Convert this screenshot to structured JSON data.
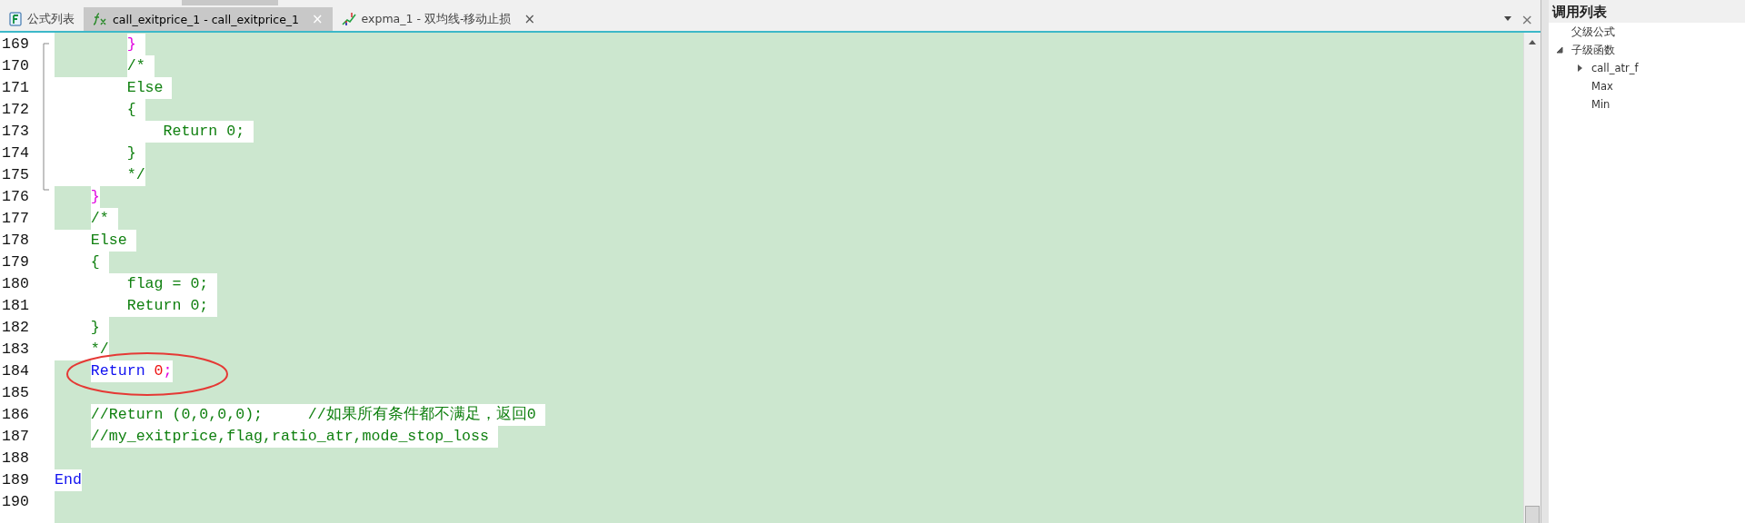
{
  "tabs": [
    {
      "label": "公式列表",
      "kind": "list",
      "selected": false
    },
    {
      "label": "call_exitprice_1 - call_exitprice_1",
      "kind": "function",
      "selected": true,
      "close": "×"
    },
    {
      "label": "expma_1 - 双均线-移动止损",
      "kind": "chart",
      "selected": false,
      "close": "×"
    }
  ],
  "tab_bar_close": "×",
  "editor": {
    "lines": [
      {
        "number": "169",
        "lead_highlight": false,
        "circled": false,
        "tokens": [
          {
            "text": "        } ",
            "kind": "brace"
          }
        ]
      },
      {
        "number": "170",
        "lead_highlight": false,
        "circled": false,
        "tokens": [
          {
            "text": "        /* ",
            "kind": "comment"
          }
        ]
      },
      {
        "number": "171",
        "lead_highlight": true,
        "circled": false,
        "tokens": [
          {
            "text": "        Else ",
            "kind": "comment"
          }
        ]
      },
      {
        "number": "172",
        "lead_highlight": true,
        "circled": false,
        "tokens": [
          {
            "text": "        { ",
            "kind": "comment"
          }
        ]
      },
      {
        "number": "173",
        "lead_highlight": true,
        "circled": false,
        "tokens": [
          {
            "text": "            Return 0; ",
            "kind": "comment"
          }
        ]
      },
      {
        "number": "174",
        "lead_highlight": true,
        "circled": false,
        "tokens": [
          {
            "text": "        } ",
            "kind": "comment"
          }
        ]
      },
      {
        "number": "175",
        "lead_highlight": true,
        "circled": false,
        "tokens": [
          {
            "text": "        */",
            "kind": "comment"
          }
        ]
      },
      {
        "number": "176",
        "lead_highlight": false,
        "circled": false,
        "tokens": [
          {
            "text": "    }",
            "kind": "brace"
          }
        ]
      },
      {
        "number": "177",
        "lead_highlight": false,
        "circled": false,
        "tokens": [
          {
            "text": "    /* ",
            "kind": "comment"
          }
        ]
      },
      {
        "number": "178",
        "lead_highlight": true,
        "circled": false,
        "tokens": [
          {
            "text": "    Else ",
            "kind": "comment"
          }
        ]
      },
      {
        "number": "179",
        "lead_highlight": true,
        "circled": false,
        "tokens": [
          {
            "text": "    { ",
            "kind": "comment"
          }
        ]
      },
      {
        "number": "180",
        "lead_highlight": true,
        "circled": false,
        "tokens": [
          {
            "text": "        flag = 0; ",
            "kind": "comment"
          }
        ]
      },
      {
        "number": "181",
        "lead_highlight": true,
        "circled": false,
        "tokens": [
          {
            "text": "        Return 0; ",
            "kind": "comment"
          }
        ]
      },
      {
        "number": "182",
        "lead_highlight": true,
        "circled": false,
        "tokens": [
          {
            "text": "    } ",
            "kind": "comment"
          }
        ]
      },
      {
        "number": "183",
        "lead_highlight": true,
        "circled": false,
        "tokens": [
          {
            "text": "    */",
            "kind": "comment"
          }
        ]
      },
      {
        "number": "184",
        "lead_highlight": false,
        "circled": true,
        "tokens": [
          {
            "text": "    Return ",
            "kind": "keyword"
          },
          {
            "text": "0",
            "kind": "number"
          },
          {
            "text": ";",
            "kind": "brace"
          }
        ]
      },
      {
        "number": "185"
      },
      {
        "number": "186",
        "lead_highlight": false,
        "circled": false,
        "tokens": [
          {
            "text": "    //Return (0,0,0,0);     //如果所有条件都不满足，返回0 ",
            "kind": "comment"
          }
        ]
      },
      {
        "number": "187",
        "lead_highlight": false,
        "circled": false,
        "tokens": [
          {
            "text": "    //my_exitprice,flag,ratio_atr,mode_stop_loss ",
            "kind": "comment"
          }
        ]
      },
      {
        "number": "188"
      },
      {
        "number": "189",
        "circled": false,
        "tokens": [
          {
            "text": "End",
            "kind": "keyword"
          }
        ]
      },
      {
        "number": "190"
      }
    ]
  },
  "call_list": {
    "title": "调用列表",
    "items": [
      {
        "label": "父级公式"
      },
      {
        "label": "子级函数",
        "expanded": true,
        "children": [
          {
            "label": "call_atr_f",
            "has_children": true
          },
          {
            "label": "Max",
            "has_children": false
          },
          {
            "label": "Min",
            "has_children": false
          }
        ]
      }
    ]
  }
}
